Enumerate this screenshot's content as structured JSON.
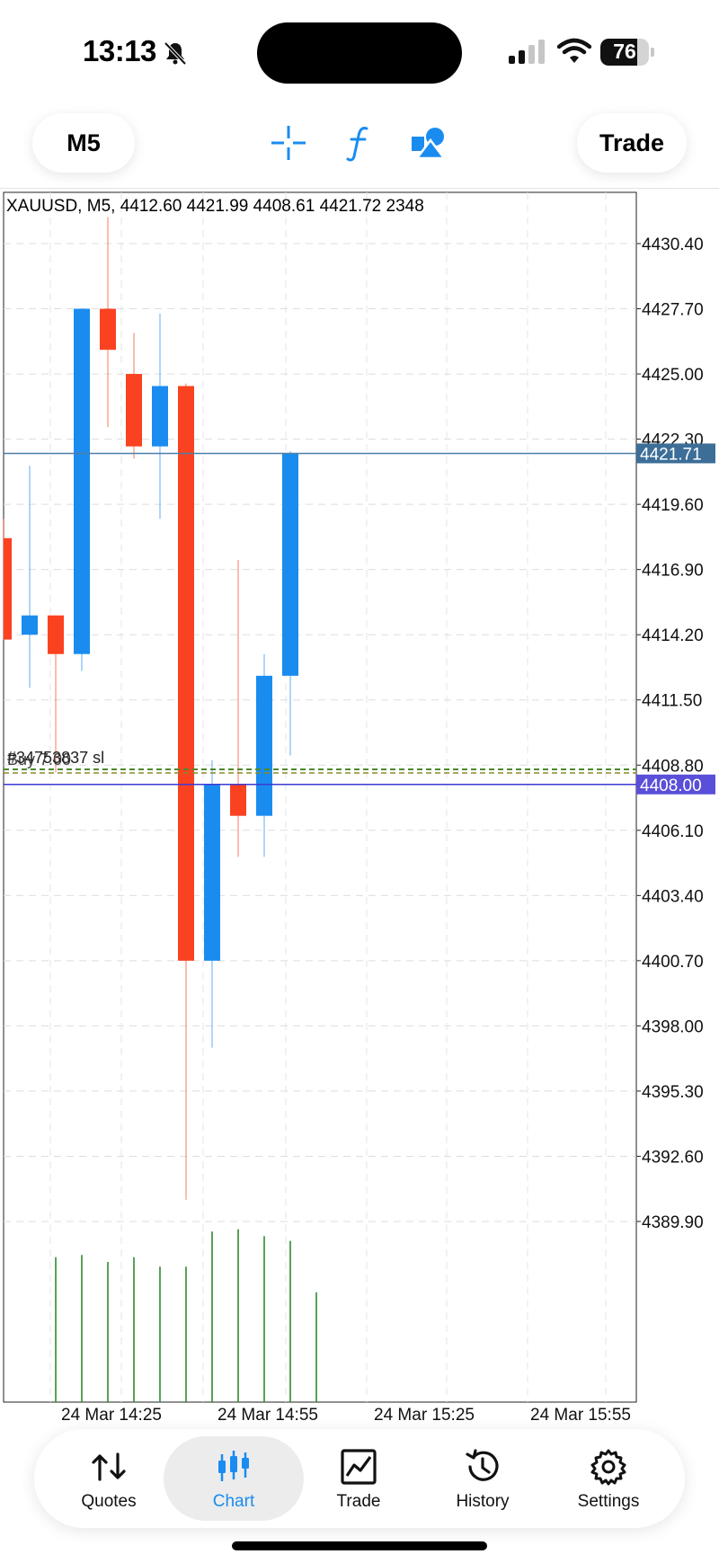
{
  "status_bar": {
    "time": "13:13",
    "battery_level": 76
  },
  "toolbar": {
    "timeframe": "M5",
    "trade_label": "Trade",
    "icons": [
      "crosshair-icon",
      "indicators-icon",
      "objects-icon"
    ]
  },
  "chart_info": "XAUUSD, M5, 4412.60 4421.99 4408.61 4421.72 2348",
  "chart_data": {
    "type": "candlestick",
    "symbol": "XAUUSD",
    "timeframe": "M5",
    "ohlc_header": {
      "open": 4412.6,
      "high": 4421.99,
      "low": 4408.61,
      "close": 4421.72,
      "volume": 2348
    },
    "ylim": [
      4387.0,
      4433.0
    ],
    "y_ticks": [
      "4430.40",
      "4427.70",
      "4425.00",
      "4422.30",
      "4419.60",
      "4416.90",
      "4414.20",
      "4411.50",
      "4408.80",
      "4406.10",
      "4403.40",
      "4400.70",
      "4398.00",
      "4395.30",
      "4392.60",
      "4389.90"
    ],
    "x_ticks": [
      "24 Mar 14:25",
      "24 Mar 14:55",
      "24 Mar 15:25",
      "24 Mar 15:55"
    ],
    "candles": [
      {
        "o": 4418.2,
        "h": 4419.0,
        "l": 4414.0,
        "c": 4414.0
      },
      {
        "o": 4414.2,
        "h": 4421.2,
        "l": 4412.0,
        "c": 4415.0
      },
      {
        "o": 4415.0,
        "h": 4415.0,
        "l": 4408.5,
        "c": 4413.4
      },
      {
        "o": 4413.4,
        "h": 4427.7,
        "l": 4412.7,
        "c": 4427.7
      },
      {
        "o": 4427.7,
        "h": 4431.5,
        "l": 4422.8,
        "c": 4426.0
      },
      {
        "o": 4425.0,
        "h": 4426.7,
        "l": 4421.5,
        "c": 4422.0
      },
      {
        "o": 4422.0,
        "h": 4427.5,
        "l": 4419.0,
        "c": 4424.5
      },
      {
        "o": 4424.5,
        "h": 4424.6,
        "l": 4390.8,
        "c": 4400.7
      },
      {
        "o": 4400.7,
        "h": 4409.0,
        "l": 4397.1,
        "c": 4408.0
      },
      {
        "o": 4408.0,
        "h": 4417.3,
        "l": 4405.0,
        "c": 4406.7
      },
      {
        "o": 4406.7,
        "h": 4413.4,
        "l": 4405.0,
        "c": 4412.5
      },
      {
        "o": 4412.5,
        "h": 4421.8,
        "l": 4409.2,
        "c": 4421.7
      }
    ],
    "volumes": [
      62,
      63,
      60,
      62,
      58,
      58,
      73,
      74,
      71,
      69,
      47
    ],
    "lines": [
      {
        "price": 4421.71,
        "label": "4421.71",
        "color": "#4a7fa8",
        "badge": "#3c6e98"
      },
      {
        "price": 4408.0,
        "label": "4408.00",
        "color": "#3b3bd6",
        "badge": "#5a4fd8"
      }
    ],
    "order_level": {
      "price": 4408.55,
      "label": "#34753837 sl",
      "label_overlap": "Buy 7.00"
    },
    "colors": {
      "bull": "#1a8cf0",
      "bear": "#fa4220",
      "volume": "#2e8b2e"
    }
  },
  "bottom_nav": {
    "active": "Chart",
    "items": [
      {
        "label": "Quotes",
        "icon": "quotes-icon"
      },
      {
        "label": "Chart",
        "icon": "chart-icon"
      },
      {
        "label": "Trade",
        "icon": "trade-icon"
      },
      {
        "label": "History",
        "icon": "history-icon"
      },
      {
        "label": "Settings",
        "icon": "settings-icon"
      }
    ]
  }
}
